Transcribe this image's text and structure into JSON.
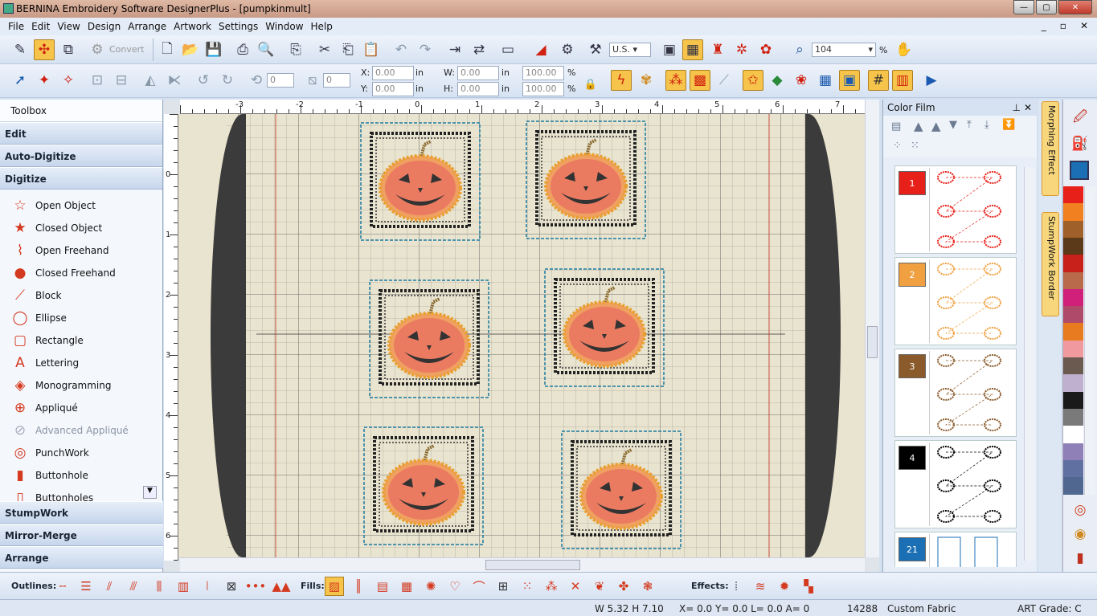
{
  "title": "BERNINA Embroidery Software DesignerPlus - [pumpkinmult]",
  "menu": [
    "File",
    "Edit",
    "View",
    "Design",
    "Arrange",
    "Artwork",
    "Settings",
    "Window",
    "Help"
  ],
  "mdi_buttons": [
    "_",
    "▫",
    "✕"
  ],
  "toolbar1": {
    "convert_label": "Convert",
    "units": "U.S.",
    "zoom": "104",
    "zoom_unit": "%"
  },
  "toolbar2": {
    "rotate_value": "0",
    "slant_value": "0",
    "x_label": "X:",
    "y_label": "Y:",
    "x": "0.00",
    "y": "0.00",
    "unit": "in",
    "w_label": "W:",
    "h_label": "H:",
    "w": "0.00",
    "h": "0.00",
    "scale_w": "100.00",
    "scale_h": "100.00",
    "pct": "%"
  },
  "toolbox": {
    "title": "Toolbox",
    "groups_top": [
      "Edit",
      "Auto-Digitize",
      "Digitize"
    ],
    "digitize_items": [
      {
        "label": "Open Object",
        "icon": "open-object-icon",
        "glyph": "☆"
      },
      {
        "label": "Closed Object",
        "icon": "closed-object-icon",
        "glyph": "★"
      },
      {
        "label": "Open Freehand",
        "icon": "open-freehand-icon",
        "glyph": "⌇"
      },
      {
        "label": "Closed Freehand",
        "icon": "closed-freehand-icon",
        "glyph": "●"
      },
      {
        "label": "Block",
        "icon": "block-icon",
        "glyph": "⟋"
      },
      {
        "label": "Ellipse",
        "icon": "ellipse-icon",
        "glyph": "◯"
      },
      {
        "label": "Rectangle",
        "icon": "rectangle-icon",
        "glyph": "▢"
      },
      {
        "label": "Lettering",
        "icon": "lettering-icon",
        "glyph": "A"
      },
      {
        "label": "Monogramming",
        "icon": "monogramming-icon",
        "glyph": "◈"
      },
      {
        "label": "Appliqué",
        "icon": "applique-icon",
        "glyph": "⊕"
      },
      {
        "label": "Advanced Appliqué",
        "icon": "advanced-applique-icon",
        "glyph": "⊘",
        "disabled": true
      },
      {
        "label": "PunchWork",
        "icon": "punchwork-icon",
        "glyph": "◎"
      },
      {
        "label": "Buttonhole",
        "icon": "buttonhole-icon",
        "glyph": "▮"
      },
      {
        "label": "Buttonholes",
        "icon": "buttonholes-icon",
        "glyph": "▯"
      }
    ],
    "groups_bottom": [
      "StumpWork",
      "Mirror-Merge",
      "Arrange"
    ]
  },
  "ruler_h": [
    "-3",
    "-2",
    "-1",
    "0",
    "1",
    "2",
    "3",
    "4",
    "5",
    "6",
    "7"
  ],
  "ruler_v": [
    "0",
    "1",
    "2",
    "3",
    "4",
    "5",
    "6"
  ],
  "color_film": {
    "title": "Color Film",
    "rows": [
      {
        "num": "1",
        "color": "#e8201a"
      },
      {
        "num": "2",
        "color": "#f0a040"
      },
      {
        "num": "3",
        "color": "#8a5a2b"
      },
      {
        "num": "4",
        "color": "#000000"
      },
      {
        "num": "21",
        "color": "#1a6fb5"
      }
    ]
  },
  "side_tabs": [
    "Morphing Effect",
    "StumpWork Border"
  ],
  "palette_colors": [
    "#e8201a",
    "#f08020",
    "#a0602a",
    "#5a3a18",
    "#c8201a",
    "#b86a4a",
    "#d0207a",
    "#b04a6a",
    "#e87a20",
    "#f09aa0",
    "#6a5a50",
    "#c0b0d0",
    "#1a1a1a",
    "#7a7a7a",
    "#ffffff",
    "#9080b8",
    "#6070a0",
    "#506890"
  ],
  "bottom": {
    "outlines_label": "Outlines:",
    "fills_label": "Fills:",
    "effects_label": "Effects:"
  },
  "status": {
    "size": "W 5.32 H 7.10",
    "coords": "X=   0.0 Y=   0.0 L=   0.0 A=   0",
    "stitches": "14288",
    "fabric": "Custom Fabric",
    "grade": "ART Grade: C"
  }
}
